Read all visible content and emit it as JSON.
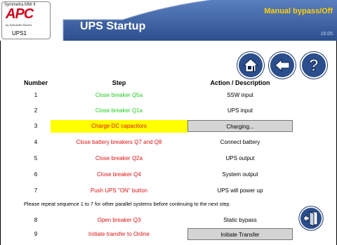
{
  "header": {
    "logo_model": "Symmetra MW II",
    "logo_brand": "APC",
    "logo_sub": "by Schneider Electric",
    "unit": "UPS1",
    "title": "UPS Startup",
    "mode": "Manual bypass/Off",
    "time": "16:05"
  },
  "nav": {
    "home": "home-icon",
    "back": "back-arrow-icon",
    "help": "help-icon",
    "exit": "exit-door-icon"
  },
  "table": {
    "headers": {
      "number": "Number",
      "step": "Step",
      "action": "Action / Description"
    },
    "rows": [
      {
        "number": "1",
        "step": "Close breaker Q5a",
        "action": "SSW input"
      },
      {
        "number": "2",
        "step": "Close breaker Q1a",
        "action": "UPS input"
      },
      {
        "number": "3",
        "step": "Charge DC capacitors",
        "action": "Charging..."
      },
      {
        "number": "4",
        "step": "Close battery breakers Q7 and Q8",
        "action": "Connect battery"
      },
      {
        "number": "5",
        "step": "Close breaker Q2a",
        "action": "UPS output"
      },
      {
        "number": "6",
        "step": "Close breaker Q4",
        "action": "System output"
      },
      {
        "number": "7",
        "step": "Push UPS \"ON\" button",
        "action": "UPS will power up"
      },
      {
        "number": "8",
        "step": "Open breaker Q3",
        "action": "Static bypass"
      },
      {
        "number": "9",
        "step": "Initiate transfer to Online",
        "action": "Initiate Transfer"
      }
    ],
    "note": "Please repeat sequence 1 to 7 for other parallel systems before continuing to the next step."
  },
  "colors": {
    "header_bg": "#3a5f9e",
    "mode_text": "#ffd000",
    "step_done": "#22cc22",
    "step_pending": "#dd1111",
    "highlight": "#ffff00"
  }
}
